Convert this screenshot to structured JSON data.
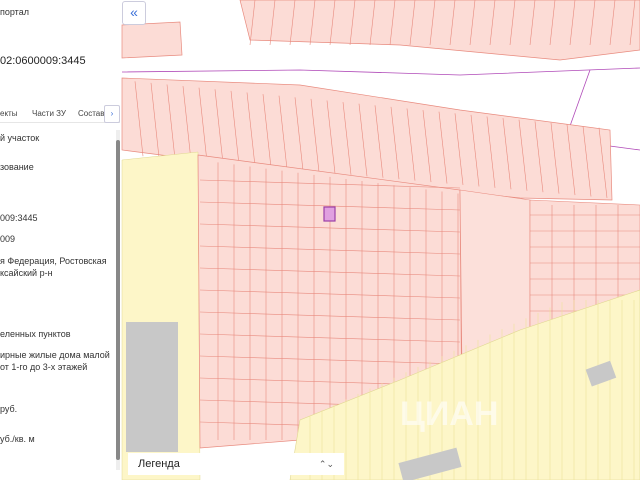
{
  "sidebar": {
    "portal_title": "портал",
    "cadastral_number": "02:0600009:3445",
    "tabs": [
      "екты",
      "Части ЗУ",
      "Состав"
    ],
    "tab_more": "›",
    "rows": [
      "й участок",
      "зование",
      "009:3445",
      "009",
      "я Федерация, Ростовская",
      "ксайский р-н",
      "еленных пунктов",
      "ирные жилые дома малой",
      "от 1-го до 3-х этажей",
      "руб.",
      "уб./кв. м"
    ]
  },
  "map": {
    "collapse_label": "«",
    "watermark": "ЦИАН",
    "legend_label": "Легенда",
    "legend_icon": "⌃⌄"
  },
  "colors": {
    "parcel_fill": "#fcdcd6",
    "parcel_stroke": "#e88a7e",
    "zone_yellow": "#fdf6c8",
    "highlight": "#9b3fa8"
  }
}
